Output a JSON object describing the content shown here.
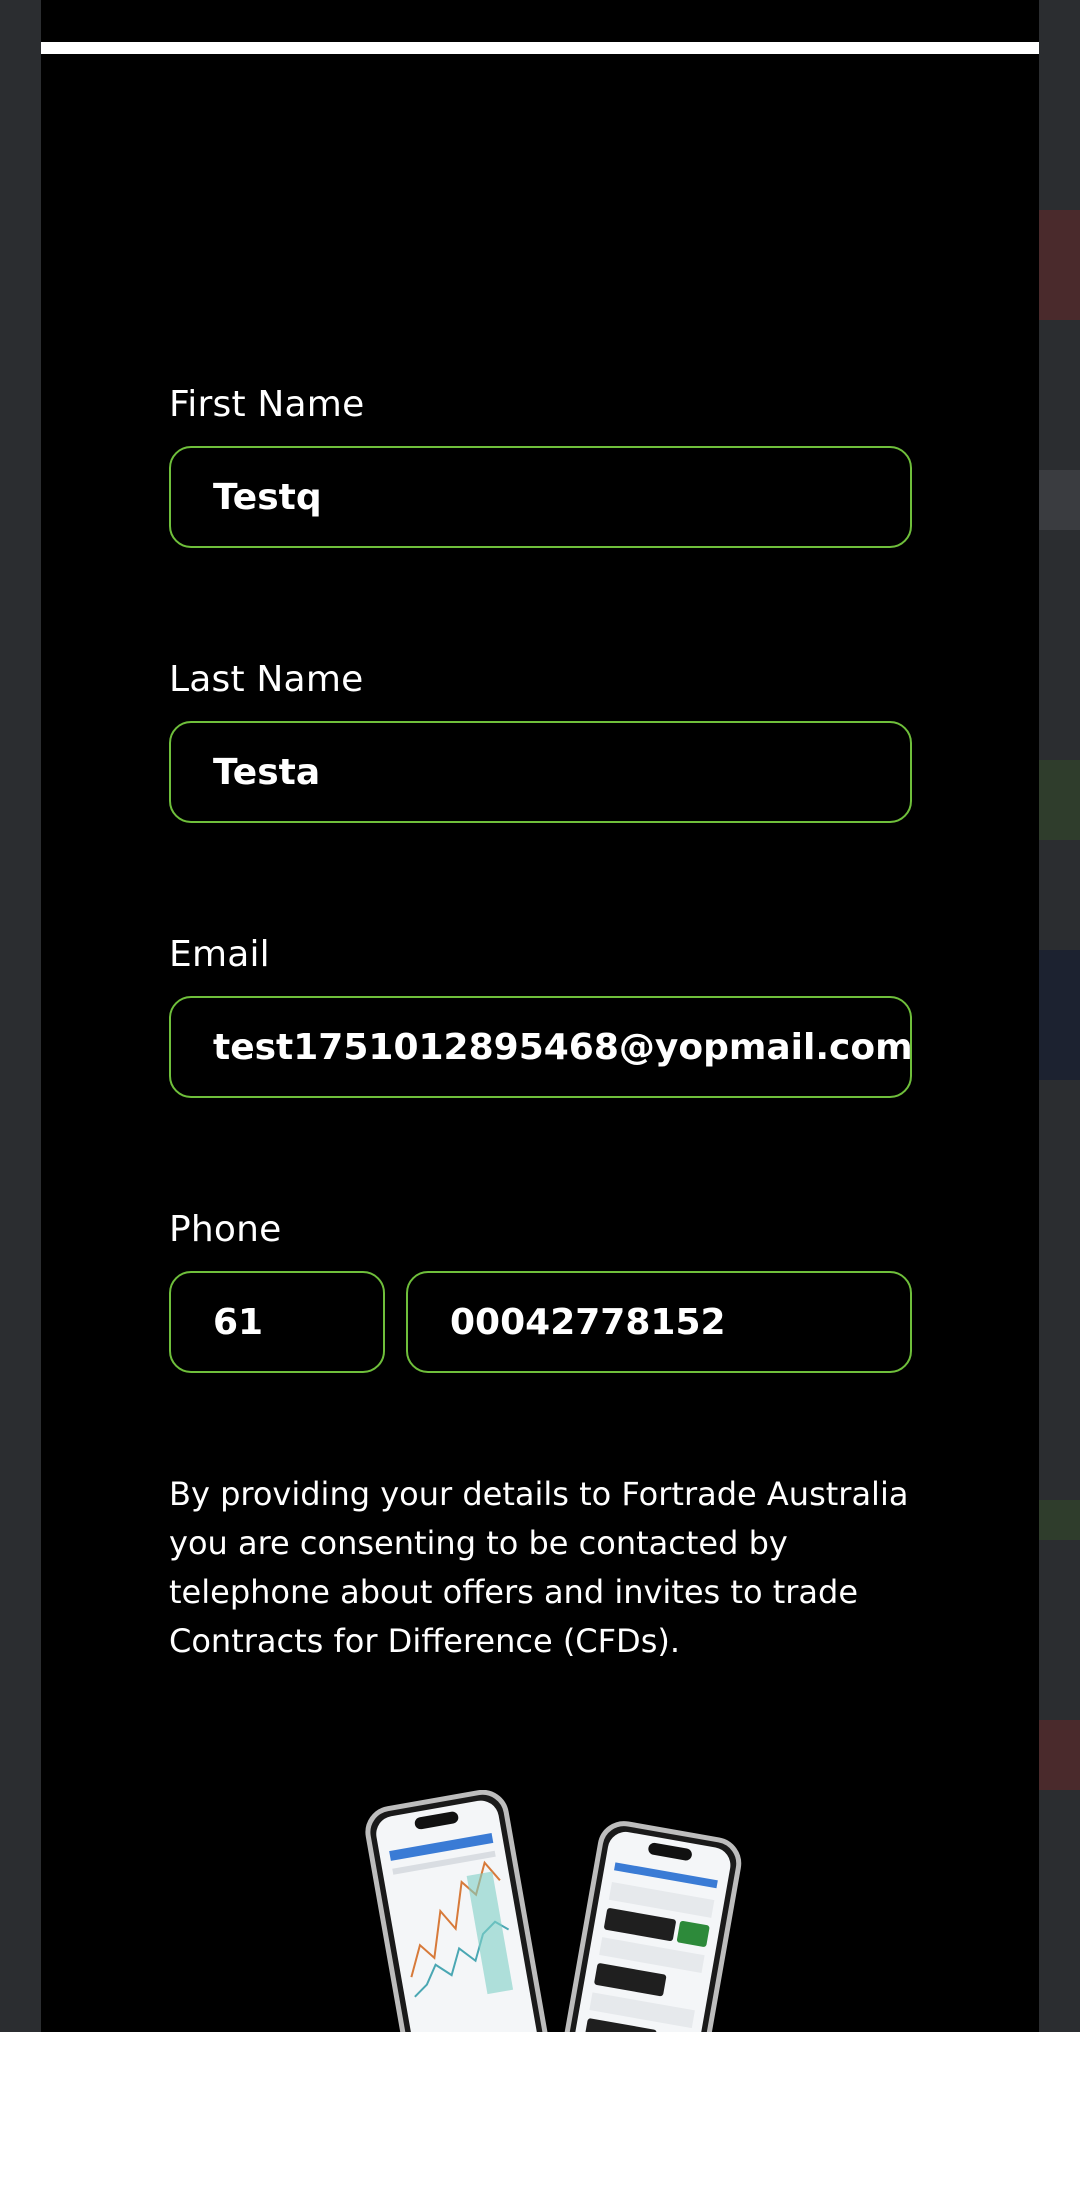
{
  "form": {
    "first_name": {
      "label": "First Name",
      "value": "Testq"
    },
    "last_name": {
      "label": "Last Name",
      "value": "Testa"
    },
    "email": {
      "label": "Email",
      "value": "test1751012895468@yopmail.com"
    },
    "phone": {
      "label": "Phone",
      "country_code": "61",
      "number": "00042778152"
    },
    "consent_text": "By providing your details to Fortrade Australia you are consenting to be contacted by telephone about offers and invites to trade Contracts for Difference (CFDs)."
  },
  "colors": {
    "modal_bg": "#000000",
    "field_border": "#6fbf3b",
    "text": "#ffffff",
    "backdrop": "#2b2d30"
  },
  "promo_image": {
    "icon": "phones-app-preview-image"
  }
}
